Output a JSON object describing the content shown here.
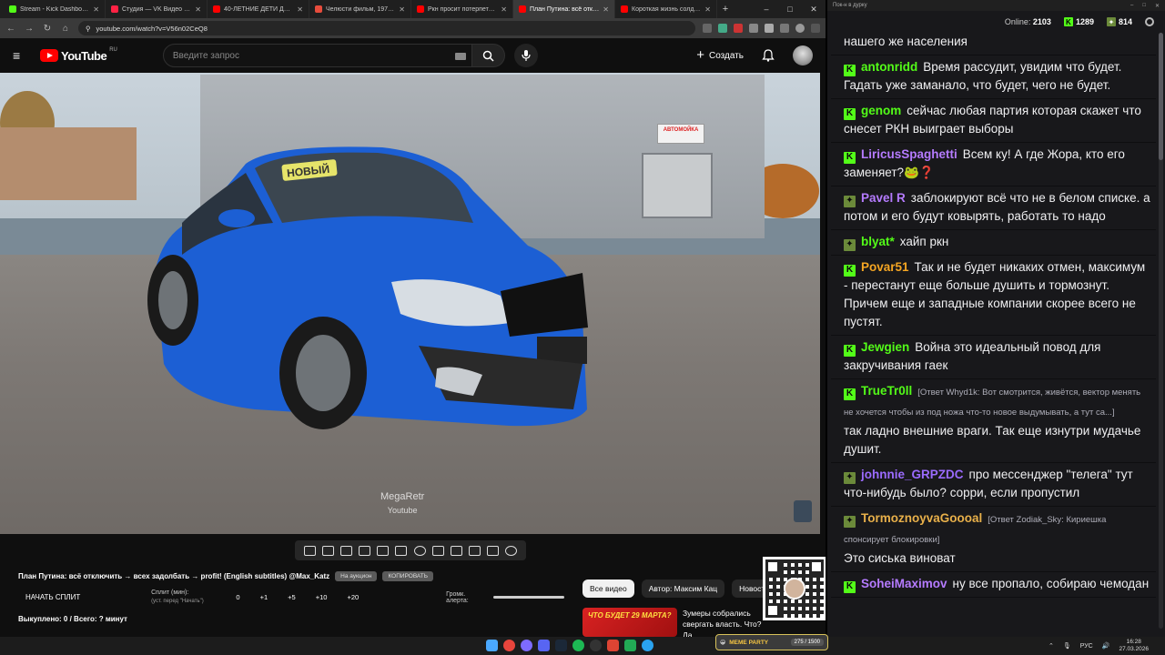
{
  "browser": {
    "tabs": [
      {
        "label": "Stream - Kick Dashboard",
        "color": "#53fc18",
        "active": false
      },
      {
        "label": "Студия — VK Видео Live",
        "color": "#ff2244",
        "active": false
      },
      {
        "label": "40-ЛЕТНИЕ ДЕТИ ДИСНЕЯ",
        "color": "#ff0000",
        "active": false
      },
      {
        "label": "Челюсти фильм, 1975, дата",
        "color": "#e74c3c",
        "active": false
      },
      {
        "label": "Ркн просит потерпеть :) - Yo",
        "color": "#ff0000",
        "active": false
      },
      {
        "label": "План Путина: всё отклю",
        "color": "#ff0000",
        "active": true
      },
      {
        "label": "Короткая жизнь солдата | С",
        "color": "#ff0000",
        "active": false
      }
    ],
    "url": "youtube.com/watch?v=V56n02CeQ8"
  },
  "youtube": {
    "logo_text": "YouTube",
    "country": "RU",
    "search_placeholder": "Введите запрос",
    "create_label": "Создать"
  },
  "video": {
    "watermark_line1": "MegaRetr",
    "watermark_line2": "Youtube",
    "sign_text": "АВТОМОЙКА",
    "plate_text": "НОВЫЙ"
  },
  "controls": {
    "title": "План Путина: всё отключить → всех задолбать → profit! (English subtitles) @Max_Katz",
    "btn_auction": "На аукцион",
    "btn_copy": "КОПИРОВАТЬ",
    "split_button": "НАЧАТЬ СПЛИТ",
    "split_label": "Сплит (мин):",
    "split_sublabel": "(уст. перед \"Начать\")",
    "split_values": [
      "0",
      "+1",
      "+5",
      "+10",
      "+20"
    ],
    "alert_label": "Громк. алерта:",
    "alert_volume": 1.0,
    "bought": "Выкуплено: 0 / Всего: ? минут"
  },
  "related": {
    "chips": [
      "Все видео",
      "Автор: Максим Кац",
      "Новост"
    ],
    "video_thumb_text": "ЧТО БУДЕТ 29 МАРТА?",
    "video_title": "Зумеры собрались свергать власть. Что? Да"
  },
  "chat": {
    "window_title": "Пок-н в дурку",
    "online_label": "Online:",
    "online_count": "2103",
    "kick_count": "1289",
    "other_count": "814",
    "messages": [
      {
        "badge": "",
        "user": "",
        "color": "#ffffff",
        "reply": "",
        "text": "нашего же населения"
      },
      {
        "badge": "kick",
        "user": "antonridd",
        "color": "#53fc18",
        "reply": "",
        "text": "Время рассудит, увидим что будет. Гадать уже заманало, что будет, чего не будет."
      },
      {
        "badge": "kick",
        "user": "genom",
        "color": "#53fc18",
        "reply": "",
        "text": "сейчас любая партия которая скажет что снесет РКН выиграет выборы"
      },
      {
        "badge": "kick",
        "user": "LiricusSpaghetti",
        "color": "#b57bff",
        "reply": "",
        "text": "Всем ку! А где Жора, кто его заменяет?🐸❓"
      },
      {
        "badge": "croc",
        "user": "Pavel R",
        "color": "#b57bff",
        "reply": "",
        "text": "заблокируют всё что не в белом списке. а потом и его будут ковырять, работать то надо"
      },
      {
        "badge": "croc",
        "user": "blyat*",
        "color": "#53fc18",
        "reply": "",
        "text": "хайп ркн"
      },
      {
        "badge": "kick",
        "user": "Povar51",
        "color": "#f5a623",
        "reply": "",
        "text": "Так и не будет никаких отмен, максимум - перестанут еще больше душить и тормознут. Причем еще и западные компании скорее всего не пустят."
      },
      {
        "badge": "kick",
        "user": "Jewgien",
        "color": "#53fc18",
        "reply": "",
        "text": "Война это идеальный повод для закручивания гаек"
      },
      {
        "badge": "kick",
        "user": "TrueTr0ll",
        "color": "#53fc18",
        "reply": "[Ответ Whyd1k: Вот смотрится, живётся, вектор менять не хочется чтобы из под ножа что-то новое выдумывать, а тут са...]",
        "text": "так ладно внешние враги. Так еще изнутри мудачье душит."
      },
      {
        "badge": "croc",
        "user": "johnnie_GRPZDC",
        "color": "#9b6bff",
        "reply": "",
        "text": "про мессенджер \"телега\" тут что-нибудь было? сорри, если пропустил"
      },
      {
        "badge": "croc",
        "user": "TormoznoyvaGoooal",
        "color": "#e8b04a",
        "reply": "[Ответ Zodiak_Sky: Кириешка спонсирует блокировки]",
        "text": "Это сиська виноват"
      },
      {
        "badge": "kick",
        "user": "SoheiMaximov",
        "color": "#b57bff",
        "reply": "",
        "text": "ну все пропало, собираю чемодан"
      }
    ]
  },
  "taskbar": {
    "meme_title": "MEME PARTY",
    "meme_count": "275 / 1500",
    "lang": "РУС",
    "time": "16:28",
    "date": "27.03.2026"
  }
}
